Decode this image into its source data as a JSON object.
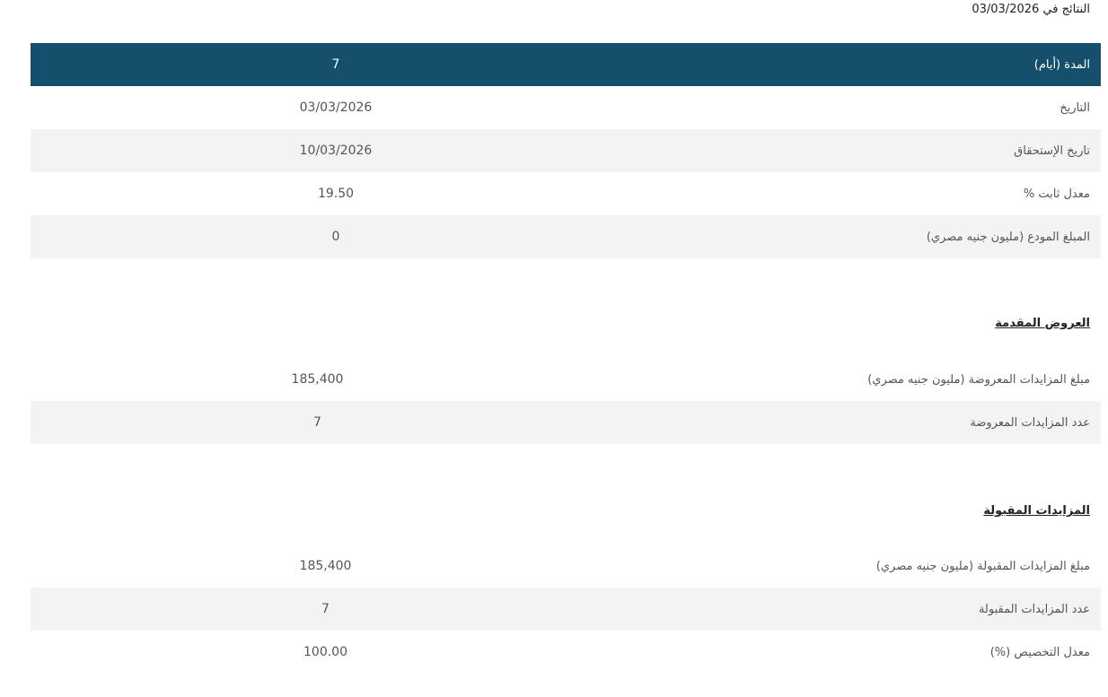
{
  "heading": "النتائج في 03/03/2026",
  "summary": {
    "rows": [
      {
        "label": "المدة (أيام)",
        "value": "7"
      },
      {
        "label": "التاريخ",
        "value": "03/03/2026"
      },
      {
        "label": "تاريخ الإستحقاق",
        "value": "10/03/2026"
      },
      {
        "label": "معدل ثابت %",
        "value": "19.50"
      },
      {
        "label": "المبلغ المودع (مليون جنيه مصري)",
        "value": "0"
      }
    ]
  },
  "offers": {
    "title": "العروض المقدمة",
    "rows": [
      {
        "label": "مبلغ المزايدات المعروضة (مليون جنيه مصري)",
        "value": "185,400"
      },
      {
        "label": "عدد المزايدات المعروضة",
        "value": "7"
      }
    ]
  },
  "accepted": {
    "title": "المزايدات المقبولة",
    "rows": [
      {
        "label": "مبلغ المزايدات المقبولة (مليون جنيه مصري)",
        "value": "185,400"
      },
      {
        "label": "عدد المزايدات المقبولة",
        "value": "7"
      },
      {
        "label": "معدل التخصيص (%)",
        "value": "100.00"
      }
    ]
  },
  "colors": {
    "header_background": "#154f6b",
    "stripe_background": "#f2f3f5"
  }
}
